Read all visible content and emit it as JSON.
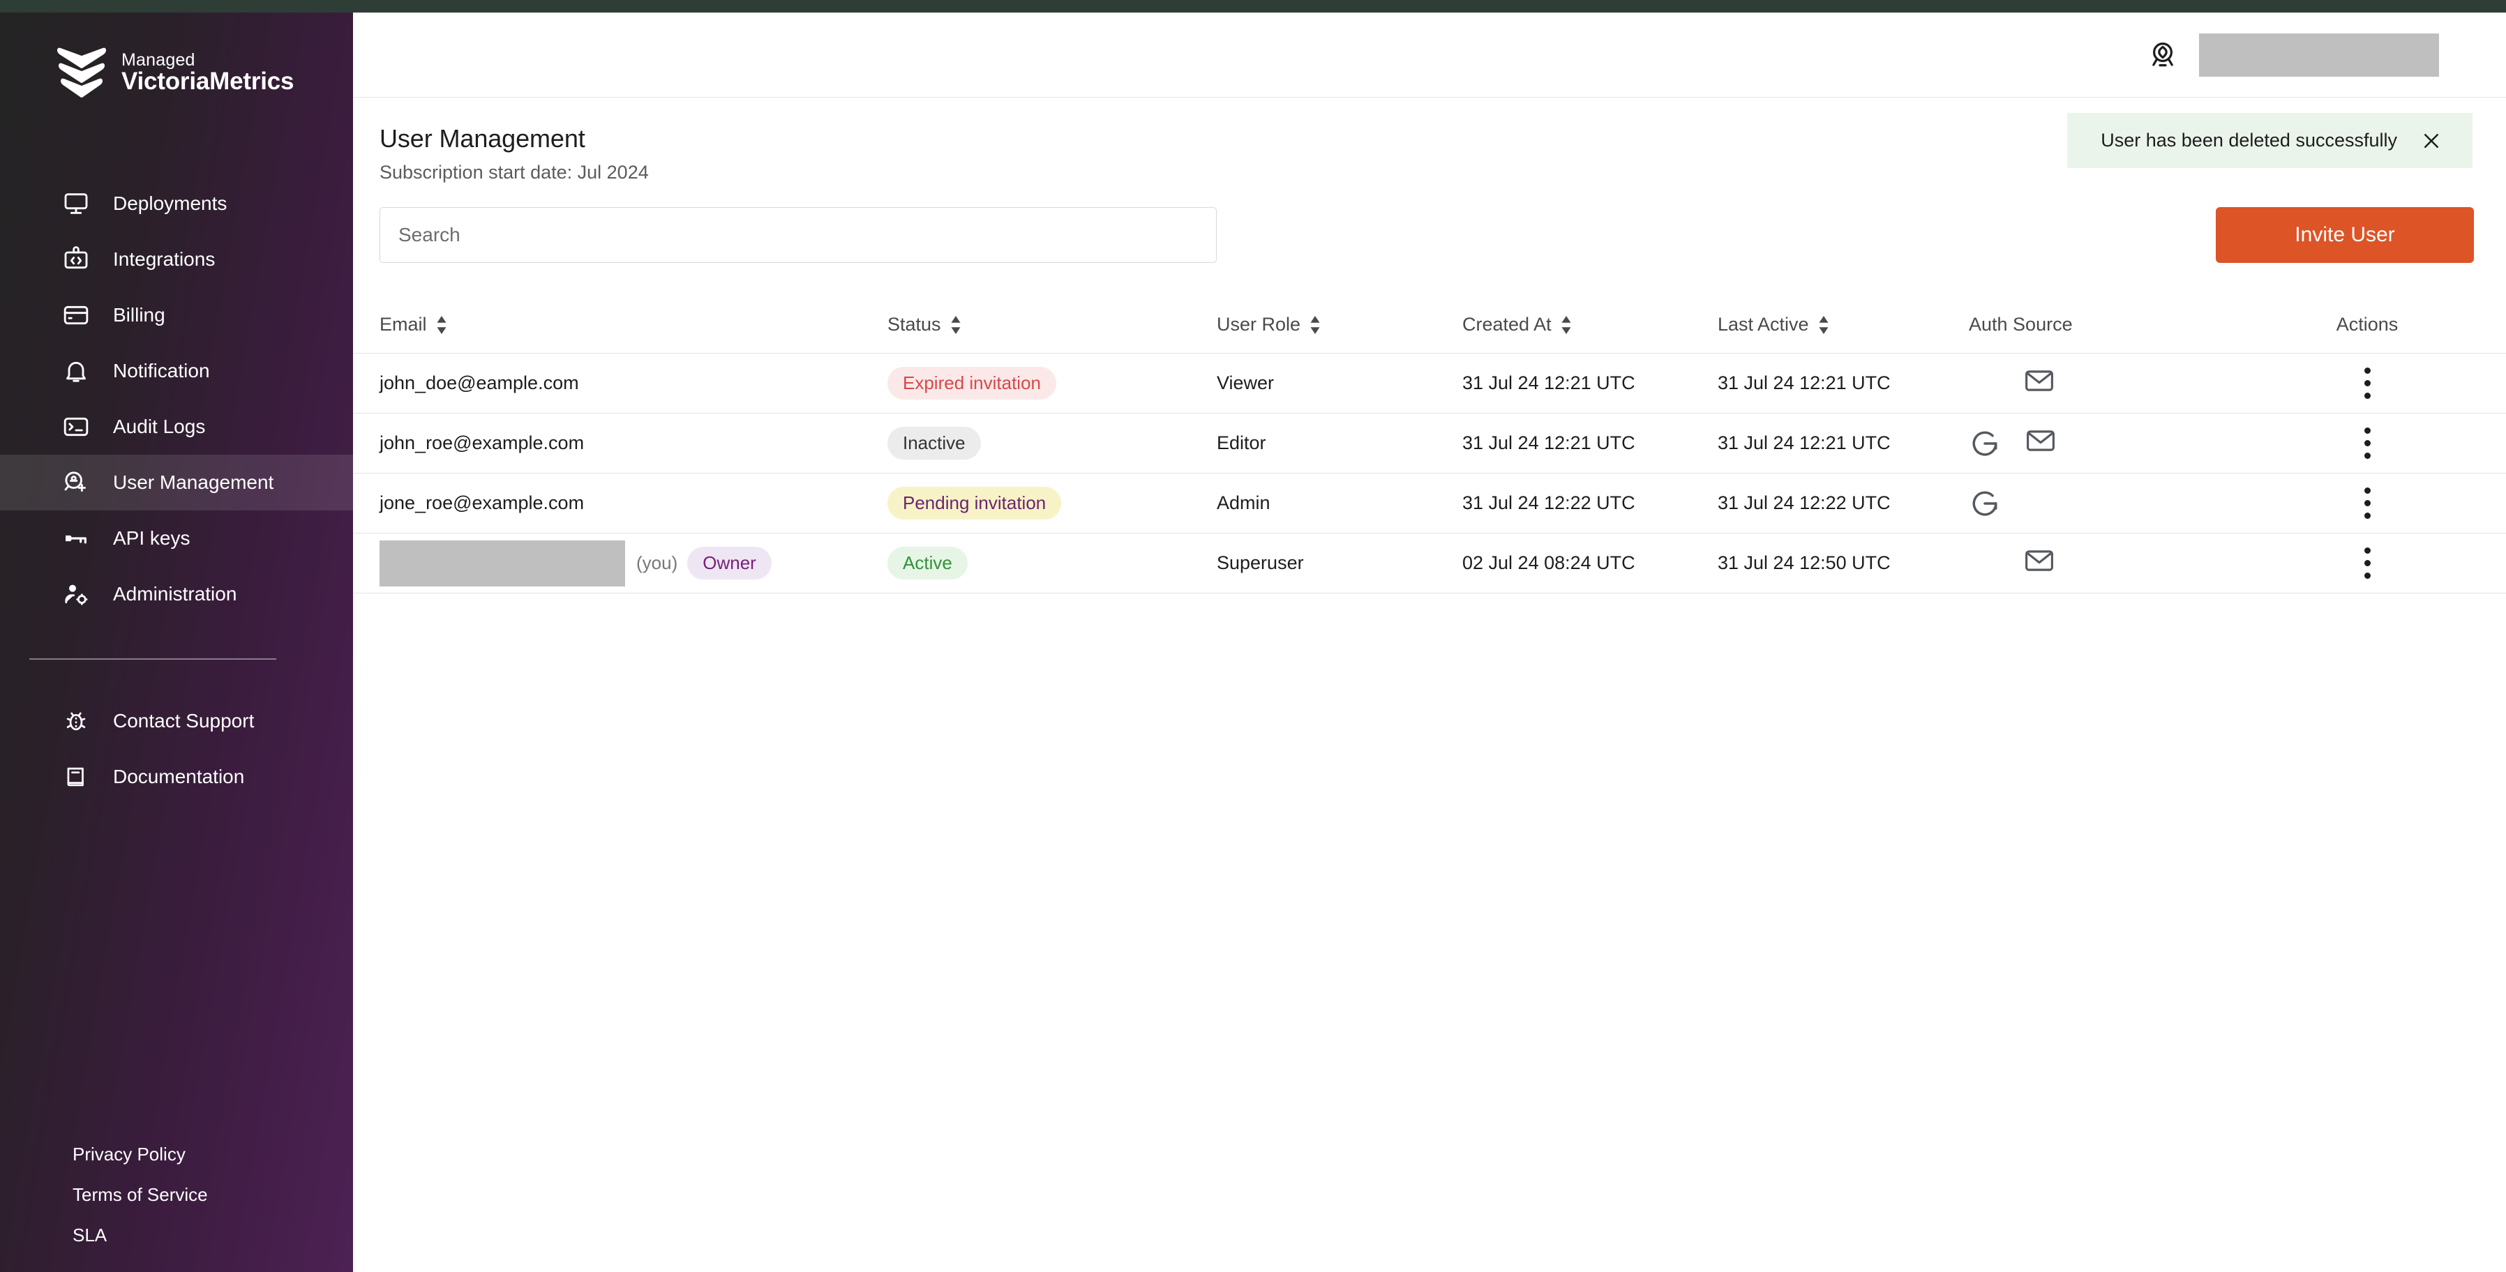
{
  "brand": {
    "line1": "Managed",
    "line2": "VictoriaMetrics",
    "logo_icon": "victoriametrics-chevrons-logo"
  },
  "sidebar": {
    "primary_items": [
      {
        "label": "Deployments",
        "icon": "monitor-icon",
        "active": false
      },
      {
        "label": "Integrations",
        "icon": "code-box-icon",
        "active": false
      },
      {
        "label": "Billing",
        "icon": "credit-card-icon",
        "active": false
      },
      {
        "label": "Notification",
        "icon": "bell-icon",
        "active": false
      },
      {
        "label": "Audit Logs",
        "icon": "terminal-icon",
        "active": false
      },
      {
        "label": "User Management",
        "icon": "user-add-icon",
        "active": true
      },
      {
        "label": "API keys",
        "icon": "key-icon",
        "active": false
      },
      {
        "label": "Administration",
        "icon": "user-gear-icon",
        "active": false
      }
    ],
    "secondary_items": [
      {
        "label": "Contact Support",
        "icon": "bug-icon"
      },
      {
        "label": "Documentation",
        "icon": "book-icon"
      }
    ],
    "footer_links": [
      {
        "label": "Privacy Policy"
      },
      {
        "label": "Terms of Service"
      },
      {
        "label": "SLA"
      }
    ]
  },
  "topbar": {
    "account_icon": "account-badge-icon",
    "user_value_redacted": true
  },
  "page": {
    "title": "User Management",
    "subtitle": "Subscription start date: Jul 2024"
  },
  "toast": {
    "message": "User has been deleted successfully",
    "close_icon": "close-icon",
    "background": "#eaf4ea"
  },
  "search": {
    "value": "",
    "placeholder": "Search"
  },
  "invite_button": {
    "label": "Invite User",
    "color": "#dd5427"
  },
  "table": {
    "columns": [
      {
        "label": "Email",
        "sortable": true
      },
      {
        "label": "Status",
        "sortable": true
      },
      {
        "label": "User Role",
        "sortable": true
      },
      {
        "label": "Created At",
        "sortable": true
      },
      {
        "label": "Last Active",
        "sortable": true
      },
      {
        "label": "Auth Source",
        "sortable": false
      },
      {
        "label": "Actions",
        "sortable": false
      }
    ],
    "rows": [
      {
        "email": "john_doe@eample.com",
        "email_redacted": false,
        "you": "",
        "owner_badge": "",
        "status": "Expired invitation",
        "status_kind": "expired",
        "role": "Viewer",
        "created_at": "31 Jul 24 12:21 UTC",
        "last_active": "31 Jul 24 12:21 UTC",
        "auth_sources": [
          "email-icon"
        ],
        "auth_offset": true
      },
      {
        "email": "john_roe@example.com",
        "email_redacted": false,
        "you": "",
        "owner_badge": "",
        "status": "Inactive",
        "status_kind": "inactive",
        "role": "Editor",
        "created_at": "31 Jul 24 12:21 UTC",
        "last_active": "31 Jul 24 12:21 UTC",
        "auth_sources": [
          "google-icon",
          "email-icon"
        ],
        "auth_offset": false
      },
      {
        "email": "jone_roe@example.com",
        "email_redacted": false,
        "you": "",
        "owner_badge": "",
        "status": "Pending invitation",
        "status_kind": "pending",
        "role": "Admin",
        "created_at": "31 Jul 24 12:22 UTC",
        "last_active": "31 Jul 24 12:22 UTC",
        "auth_sources": [
          "google-icon"
        ],
        "auth_offset": false
      },
      {
        "email": "",
        "email_redacted": true,
        "you": "(you)",
        "owner_badge": "Owner",
        "status": "Active",
        "status_kind": "active",
        "role": "Superuser",
        "created_at": "02 Jul 24 08:24 UTC",
        "last_active": "31 Jul 24 12:50 UTC",
        "auth_sources": [
          "email-icon"
        ],
        "auth_offset": true
      }
    ],
    "row_action_icon": "kebab-menu-icon"
  },
  "colors": {
    "accent": "#dd5427",
    "sidebar_start": "#242424",
    "sidebar_end": "#4d2154",
    "top_strip": "#2e3d36",
    "status_expired": "#d84848",
    "status_inactive": "#333333",
    "status_pending": "#6b2470",
    "status_active": "#35903b",
    "owner_badge": "#75207d"
  }
}
